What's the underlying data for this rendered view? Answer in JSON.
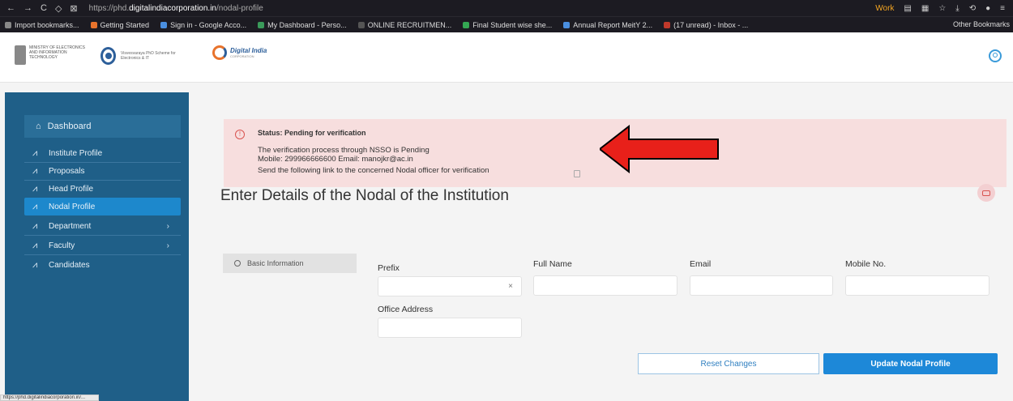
{
  "browser": {
    "url_prefix": "https://phd.",
    "url_domain": "digitalindiacorporation.in",
    "url_path": "/nodal-profile",
    "work_label": "Work",
    "bookmarks": [
      {
        "label": "Import bookmarks...",
        "color": "#888888"
      },
      {
        "label": "Getting Started",
        "color": "#e8732c"
      },
      {
        "label": "Sign in - Google Acco...",
        "color": "#4a8fe0"
      },
      {
        "label": "My Dashboard - Perso...",
        "color": "#3a9a5a"
      },
      {
        "label": "ONLINE RECRUITMEN...",
        "color": "#555555"
      },
      {
        "label": "Final Student wise she...",
        "color": "#34a853"
      },
      {
        "label": "Annual Report MeitY 2...",
        "color": "#4a8fe0"
      },
      {
        "label": "(17 unread) - Inbox - ...",
        "color": "#c0392b"
      }
    ],
    "other_bookmarks": "Other Bookmarks",
    "status_url": "https://phd.digitalindiacorporation.in/..."
  },
  "header": {
    "logo1_text": "MINISTRY OF ELECTRONICS AND INFORMATION TECHNOLOGY",
    "logo2_text": "Visvesvaraya PhD Scheme for Electronics & IT",
    "logo3_title": "Digital India",
    "logo3_sub": "CORPORATION"
  },
  "sidebar": {
    "dashboard": "Dashboard",
    "items": [
      {
        "label": "Institute Profile"
      },
      {
        "label": "Proposals"
      },
      {
        "label": "Head Profile"
      },
      {
        "label": "Nodal Profile",
        "active": true
      },
      {
        "label": "Department",
        "chevron": "›"
      },
      {
        "label": "Faculty",
        "chevron": "›"
      },
      {
        "label": "Candidates"
      }
    ]
  },
  "alert": {
    "status": "Status: Pending for verification",
    "line1": "The verification process through NSSO is Pending",
    "line2": "Mobile: 299966666600 Email: manojkr@ac.in",
    "line3": "Send the following link to the concerned Nodal officer for verification"
  },
  "page": {
    "title": "Enter Details of the Nodal of the Institution",
    "tab": "Basic Information"
  },
  "form": {
    "prefix_label": "Prefix",
    "fullname_label": "Full Name",
    "email_label": "Email",
    "mobile_label": "Mobile No.",
    "office_label": "Office Address",
    "clear": "×"
  },
  "buttons": {
    "reset": "Reset Changes",
    "update": "Update Nodal Profile"
  },
  "colors": {
    "sidebar": "#1f5f88",
    "active": "#1d88cc",
    "alert_bg": "#f7dede",
    "arrow": "#e8201a",
    "primary": "#1d88d8"
  }
}
